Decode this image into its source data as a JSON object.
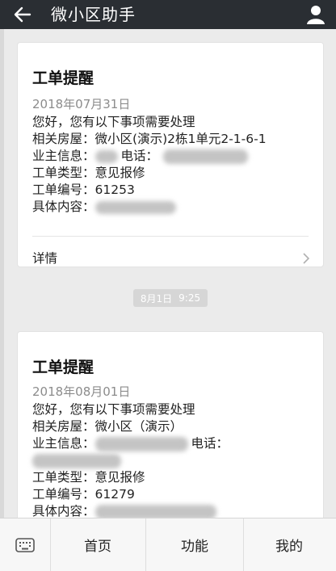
{
  "topbar": {
    "title": "微小区助手",
    "back_icon": "arrow-left-icon",
    "user_icon": "user-icon"
  },
  "cards": [
    {
      "title": "工单提醒",
      "date": "2018年07月31日",
      "greeting": "您好，您有以下事项需要处理",
      "house_label": "相关房屋：",
      "house_value": "微小区(演示)2栋1单元2-1-6-1",
      "owner_label": "业主信息：",
      "phone_label": "电话：",
      "type_label": "工单类型：",
      "type_value": "意见报修",
      "number_label": "工单编号：",
      "number_value": "61253",
      "content_label": "具体内容：",
      "details_label": "详情"
    },
    {
      "title": "工单提醒",
      "date": "2018年08月01日",
      "greeting": "您好，您有以下事项需要处理",
      "house_label": "相关房屋：",
      "house_value": "微小区（演示）",
      "owner_label": "业主信息：",
      "phone_label": "电话：",
      "type_label": "工单类型：",
      "type_value": "意见报修",
      "number_label": "工单编号：",
      "number_value": "61279",
      "content_label": "具体内容："
    }
  ],
  "time_separator": {
    "date": "8月1日",
    "time": "9:25"
  },
  "bottombar": {
    "keyboard_icon": "keyboard-icon",
    "tabs": [
      "首页",
      "功能",
      "我的"
    ]
  },
  "colors": {
    "topbar": "#2a2e33",
    "background": "#ebebeb",
    "card": "#ffffff"
  }
}
